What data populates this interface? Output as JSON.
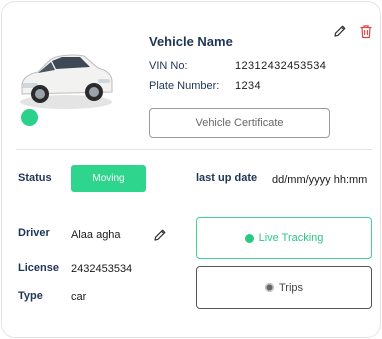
{
  "vehicle": {
    "title": "Vehicle Name",
    "vin_label": "VIN No:",
    "vin_value": "12312432453534",
    "plate_label": "Plate Number:",
    "plate_value": "1234",
    "certificate_button": "Vehicle Certificate",
    "online_color": "#2bd18a"
  },
  "details": {
    "status_label": "Status",
    "status_value": "Moving",
    "last_update_label": "last up date",
    "last_update_value": "dd/mm/yyyy hh:mm",
    "driver_label": "Driver",
    "driver_value": "Alaa agha",
    "license_label": "License",
    "license_value": "2432453534",
    "type_label": "Type",
    "type_value": "car"
  },
  "actions": {
    "live_tracking": "Live Tracking",
    "trips": "Trips"
  },
  "icons": {
    "edit": "pencil-icon",
    "delete": "trash-icon",
    "car": "car-image"
  },
  "colors": {
    "accent_green": "#2dd58d",
    "delete_red": "#e0433f",
    "heading_navy": "#1f3555"
  }
}
